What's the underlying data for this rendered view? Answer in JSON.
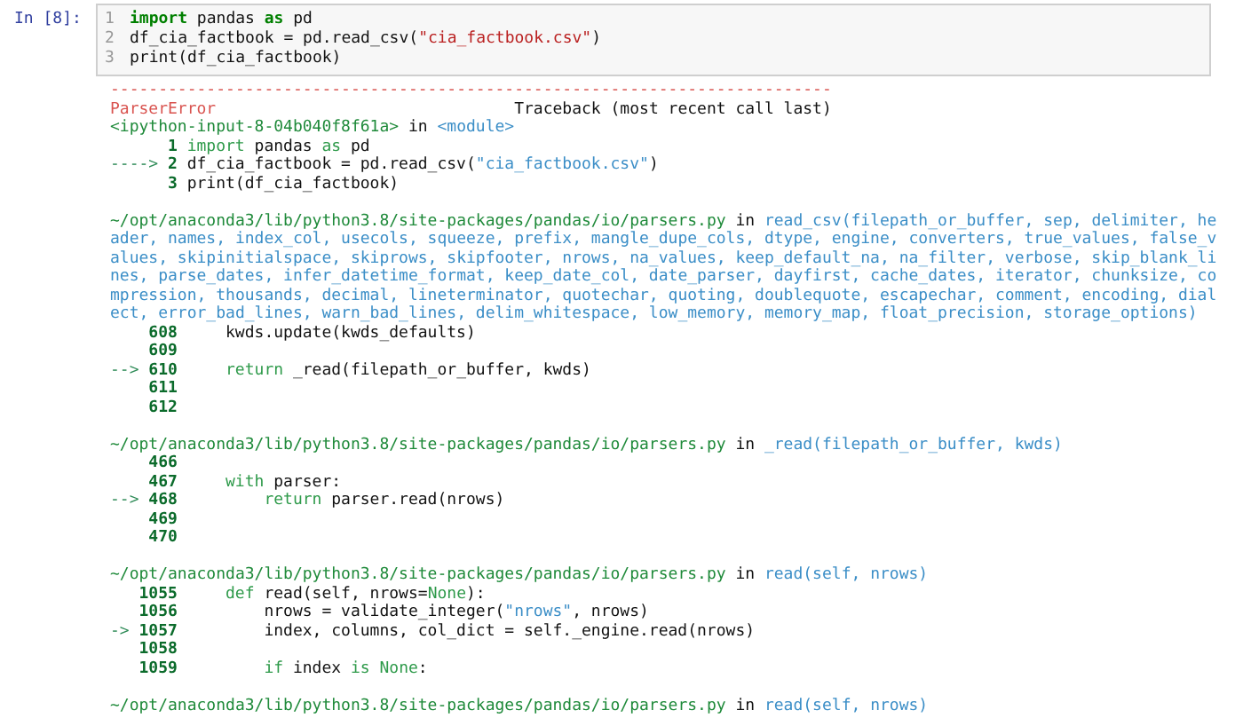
{
  "cell": {
    "prompt": "In [8]:",
    "lines": [
      {
        "number": "1",
        "tokens": [
          {
            "t": "import",
            "kind": "kw"
          },
          {
            "t": " pandas ",
            "kind": "plain"
          },
          {
            "t": "as",
            "kind": "kw"
          },
          {
            "t": " pd",
            "kind": "plain"
          }
        ]
      },
      {
        "number": "2",
        "tokens": [
          {
            "t": "df_cia_factbook = pd.read_csv(",
            "kind": "plain"
          },
          {
            "t": "\"cia_factbook.csv\"",
            "kind": "str"
          },
          {
            "t": ")",
            "kind": "plain"
          }
        ]
      },
      {
        "number": "3",
        "tokens": [
          {
            "t": "print(df_cia_factbook)",
            "kind": "plain"
          }
        ]
      }
    ]
  },
  "traceback": [
    {
      "lines": [
        {
          "tokens": [
            {
              "t": "---------------------------------------------------------------------------",
              "kind": "err"
            }
          ]
        },
        {
          "tokens": [
            {
              "t": "ParserError",
              "kind": "err"
            },
            {
              "t": "                               Traceback (most recent call last)",
              "kind": "plain"
            }
          ]
        },
        {
          "tokens": [
            {
              "t": "<ipython-input-8-04b040f8f61a>",
              "kind": "path"
            },
            {
              "t": " in ",
              "kind": "plain"
            },
            {
              "t": "<module>",
              "kind": "func"
            }
          ]
        },
        {
          "number": "1",
          "tokens": [
            {
              "t": " import",
              "kind": "tkw"
            },
            {
              "t": " pandas ",
              "kind": "plain"
            },
            {
              "t": "as",
              "kind": "tkw"
            },
            {
              "t": " pd",
              "kind": "plain"
            }
          ]
        },
        {
          "arrow": "---->",
          "number": "2",
          "tokens": [
            {
              "t": " df_cia_factbook = pd.read_csv(",
              "kind": "plain"
            },
            {
              "t": "\"cia_factbook.csv\"",
              "kind": "func"
            },
            {
              "t": ")",
              "kind": "plain"
            }
          ]
        },
        {
          "number": "3",
          "tokens": [
            {
              "t": " print(df_cia_factbook)",
              "kind": "plain"
            }
          ]
        }
      ]
    },
    {
      "lines": [
        {
          "tokens": [
            {
              "t": "~/opt/anaconda3/lib/python3.8/site-packages/pandas/io/parsers.py",
              "kind": "path"
            },
            {
              "t": " in ",
              "kind": "plain"
            },
            {
              "t": "read_csv(filepath_or_buffer, sep, delimiter, he",
              "kind": "func"
            }
          ]
        },
        {
          "tokens": [
            {
              "t": "ader, names, index_col, usecols, squeeze, prefix, mangle_dupe_cols, dtype, engine, converters, true_values, false_v",
              "kind": "func"
            }
          ]
        },
        {
          "tokens": [
            {
              "t": "alues, skipinitialspace, skiprows, skipfooter, nrows, na_values, keep_default_na, na_filter, verbose, skip_blank_li",
              "kind": "func"
            }
          ]
        },
        {
          "tokens": [
            {
              "t": "nes, parse_dates, infer_datetime_format, keep_date_col, date_parser, dayfirst, cache_dates, iterator, chunksize, co",
              "kind": "func"
            }
          ]
        },
        {
          "tokens": [
            {
              "t": "mpression, thousands, decimal, lineterminator, quotechar, quoting, doublequote, escapechar, comment, encoding, dial",
              "kind": "func"
            }
          ]
        },
        {
          "tokens": [
            {
              "t": "ect, error_bad_lines, warn_bad_lines, delim_whitespace, low_memory, memory_map, float_precision, storage_options)",
              "kind": "func"
            }
          ]
        },
        {
          "number": "608",
          "tokens": [
            {
              "t": "     kwds.update(kwds_defaults)",
              "kind": "plain"
            }
          ]
        },
        {
          "number": "609"
        },
        {
          "arrow": "-->",
          "number": "610",
          "tokens": [
            {
              "t": "     return",
              "kind": "tkw"
            },
            {
              "t": " _read(filepath_or_buffer, kwds)",
              "kind": "plain"
            }
          ]
        },
        {
          "number": "611"
        },
        {
          "number": "612"
        }
      ]
    },
    {
      "lines": [
        {
          "tokens": [
            {
              "t": "~/opt/anaconda3/lib/python3.8/site-packages/pandas/io/parsers.py",
              "kind": "path"
            },
            {
              "t": " in ",
              "kind": "plain"
            },
            {
              "t": "_read(filepath_or_buffer, kwds)",
              "kind": "func"
            }
          ]
        },
        {
          "number": "466"
        },
        {
          "number": "467",
          "tokens": [
            {
              "t": "     with",
              "kind": "tkw"
            },
            {
              "t": " parser:",
              "kind": "plain"
            }
          ]
        },
        {
          "arrow": "-->",
          "number": "468",
          "tokens": [
            {
              "t": "         return",
              "kind": "tkw"
            },
            {
              "t": " parser.read(nrows)",
              "kind": "plain"
            }
          ]
        },
        {
          "number": "469"
        },
        {
          "number": "470"
        }
      ]
    },
    {
      "lines": [
        {
          "tokens": [
            {
              "t": "~/opt/anaconda3/lib/python3.8/site-packages/pandas/io/parsers.py",
              "kind": "path"
            },
            {
              "t": " in ",
              "kind": "plain"
            },
            {
              "t": "read(self, nrows)",
              "kind": "func"
            }
          ]
        },
        {
          "number": "1055",
          "tokens": [
            {
              "t": "     def",
              "kind": "tkw"
            },
            {
              "t": " read(self, nrows=",
              "kind": "plain"
            },
            {
              "t": "None",
              "kind": "tkw"
            },
            {
              "t": "):",
              "kind": "plain"
            }
          ]
        },
        {
          "number": "1056",
          "tokens": [
            {
              "t": "         nrows = validate_integer(",
              "kind": "plain"
            },
            {
              "t": "\"nrows\"",
              "kind": "func"
            },
            {
              "t": ", nrows)",
              "kind": "plain"
            }
          ]
        },
        {
          "arrow": "->",
          "number": "1057",
          "tokens": [
            {
              "t": "         index, columns, col_dict = self._engine.read(nrows)",
              "kind": "plain"
            }
          ]
        },
        {
          "number": "1058"
        },
        {
          "number": "1059",
          "tokens": [
            {
              "t": "         if",
              "kind": "tkw"
            },
            {
              "t": " index ",
              "kind": "plain"
            },
            {
              "t": "is",
              "kind": "tkw"
            },
            {
              "t": " None",
              "kind": "tkw"
            },
            {
              "t": ":",
              "kind": "plain"
            }
          ]
        }
      ]
    },
    {
      "lines": [
        {
          "tokens": [
            {
              "t": "~/opt/anaconda3/lib/python3.8/site-packages/pandas/io/parsers.py",
              "kind": "path"
            },
            {
              "t": " in ",
              "kind": "plain"
            },
            {
              "t": "read(self, nrows)",
              "kind": "func"
            }
          ]
        }
      ]
    }
  ]
}
